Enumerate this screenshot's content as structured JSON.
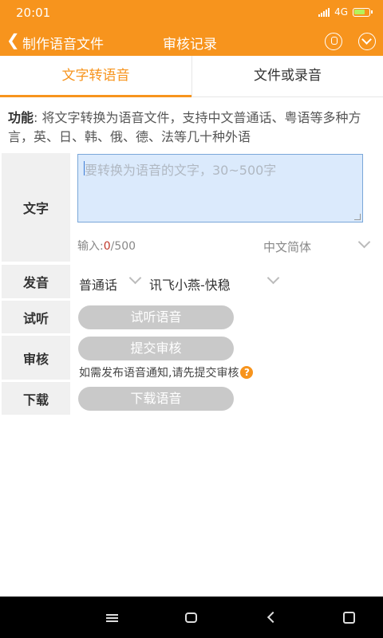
{
  "status": {
    "time": "20:01",
    "network": "4G"
  },
  "header": {
    "back_label": "制作语音文件",
    "center_title": "审核记录"
  },
  "tabs": [
    "文字转语音",
    "文件或录音"
  ],
  "description": {
    "prefix": "功能",
    "text": ": 将文字转换为语音文件，支持中文普通话、粤语等多种方言，英、日、韩、俄、德、法等几十种外语"
  },
  "form": {
    "text_label": "文字",
    "text_placeholder": "要转换为语音的文字，30~500字",
    "count_prefix": "输入:",
    "count_current": "0",
    "count_max": "/500",
    "script_option": "中文简体",
    "voice_label": "发音",
    "dialect": "普通话",
    "speaker": "讯飞小燕-快稳",
    "listen_label": "试听",
    "listen_button": "试听语音",
    "review_label": "审核",
    "review_button": "提交审核",
    "review_hint": "如需发布语音通知,请先提交审核",
    "download_label": "下载",
    "download_button": "下载语音"
  },
  "colors": {
    "accent": "#f7941d",
    "input_bg": "#dbeafc",
    "button_disabled": "#c9c9c9"
  },
  "icons": [
    "back-icon",
    "chat-icon",
    "dropdown-icon",
    "help-icon",
    "menu-icon",
    "home-icon",
    "nav-back-icon",
    "rotate-icon"
  ]
}
